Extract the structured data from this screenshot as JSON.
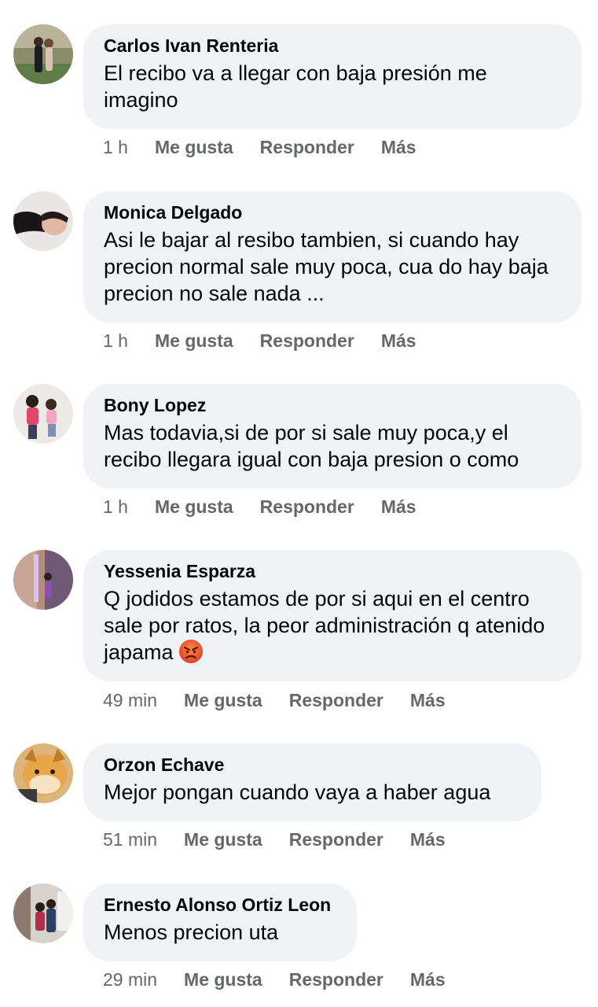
{
  "comments": [
    {
      "author": "Carlos Ivan Renteria",
      "text": "El recibo va a llegar con baja presión me imagino",
      "time": "1 h",
      "like": "Me gusta",
      "reply": "Responder",
      "more": "Más"
    },
    {
      "author": "Monica Delgado",
      "text": "Asi le bajar al resibo tambien, si cuando hay precion normal sale muy poca, cua do hay baja precion no sale nada ...",
      "time": "1 h",
      "like": "Me gusta",
      "reply": "Responder",
      "more": "Más"
    },
    {
      "author": "Bony Lopez",
      "text": "Mas todavia,si de por si sale muy poca,y el recibo llegara igual con baja presion o como",
      "time": "1 h",
      "like": "Me gusta",
      "reply": "Responder",
      "more": "Más"
    },
    {
      "author": "Yessenia Esparza",
      "text": "Q jodidos estamos de por si aqui en el centro sale por ratos, la peor administración q atenido japama",
      "emoji": "angry-face-emoji",
      "time": "49 min",
      "like": "Me gusta",
      "reply": "Responder",
      "more": "Más"
    },
    {
      "author": "Orzon Echave",
      "text": "Mejor pongan cuando vaya a haber agua",
      "time": "51 min",
      "like": "Me gusta",
      "reply": "Responder",
      "more": "Más"
    },
    {
      "author": "Ernesto Alonso Ortiz Leon",
      "text": "Menos precion uta",
      "time": "29 min",
      "like": "Me gusta",
      "reply": "Responder",
      "more": "Más"
    }
  ],
  "colors": {
    "bubble": "#f0f2f5",
    "meta": "#65676b",
    "text": "#050505"
  }
}
